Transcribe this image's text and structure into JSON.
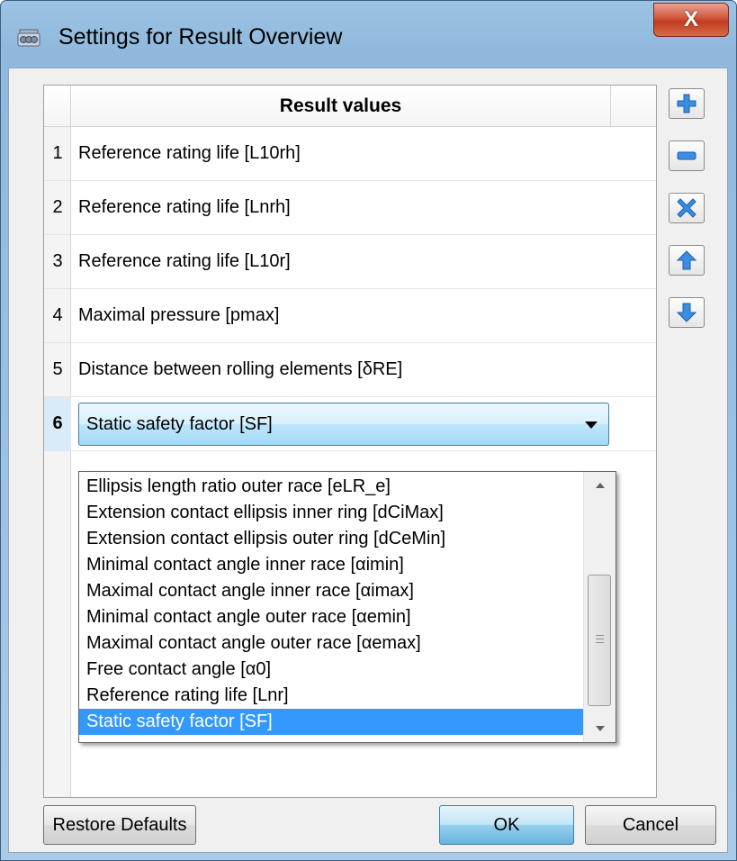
{
  "window": {
    "title": "Settings for Result Overview",
    "close_glyph": "X",
    "app_icon": "bearing-icon"
  },
  "table": {
    "column_header": "Result values",
    "rows": [
      {
        "num": "1",
        "value": "Reference rating life [L10rh]"
      },
      {
        "num": "2",
        "value": "Reference rating life [Lnrh]"
      },
      {
        "num": "3",
        "value": "Reference rating life [L10r]"
      },
      {
        "num": "4",
        "value": "Maximal pressure [pmax]"
      },
      {
        "num": "5",
        "value": "Distance between rolling elements [δRE]"
      },
      {
        "num": "6",
        "value": "Static safety factor [SF]"
      }
    ]
  },
  "dropdown": {
    "items": [
      "Ellipsis length ratio outer race [eLR_e]",
      "Extension contact ellipsis inner ring [dCiMax]",
      "Extension contact ellipsis outer ring [dCeMin]",
      "Minimal contact angle inner race [αimin]",
      "Maximal contact angle inner race [αimax]",
      "Minimal contact angle outer race [αemin]",
      "Maximal contact angle outer race [αemax]",
      "Free contact angle [α0]",
      "Reference rating life [Lnr]",
      "Static safety factor [SF]"
    ],
    "selected_index": 9
  },
  "side_buttons": [
    {
      "name": "add-row-button",
      "icon": "plus-icon"
    },
    {
      "name": "remove-row-button",
      "icon": "minus-icon"
    },
    {
      "name": "delete-all-button",
      "icon": "x-icon"
    },
    {
      "name": "move-up-button",
      "icon": "arrow-up-icon"
    },
    {
      "name": "move-down-button",
      "icon": "arrow-down-icon"
    }
  ],
  "buttons": {
    "restore_defaults": "Restore Defaults",
    "ok": "OK",
    "cancel": "Cancel"
  },
  "colors": {
    "selection": "#3399ff",
    "icon_blue": "#2a7fd4"
  }
}
